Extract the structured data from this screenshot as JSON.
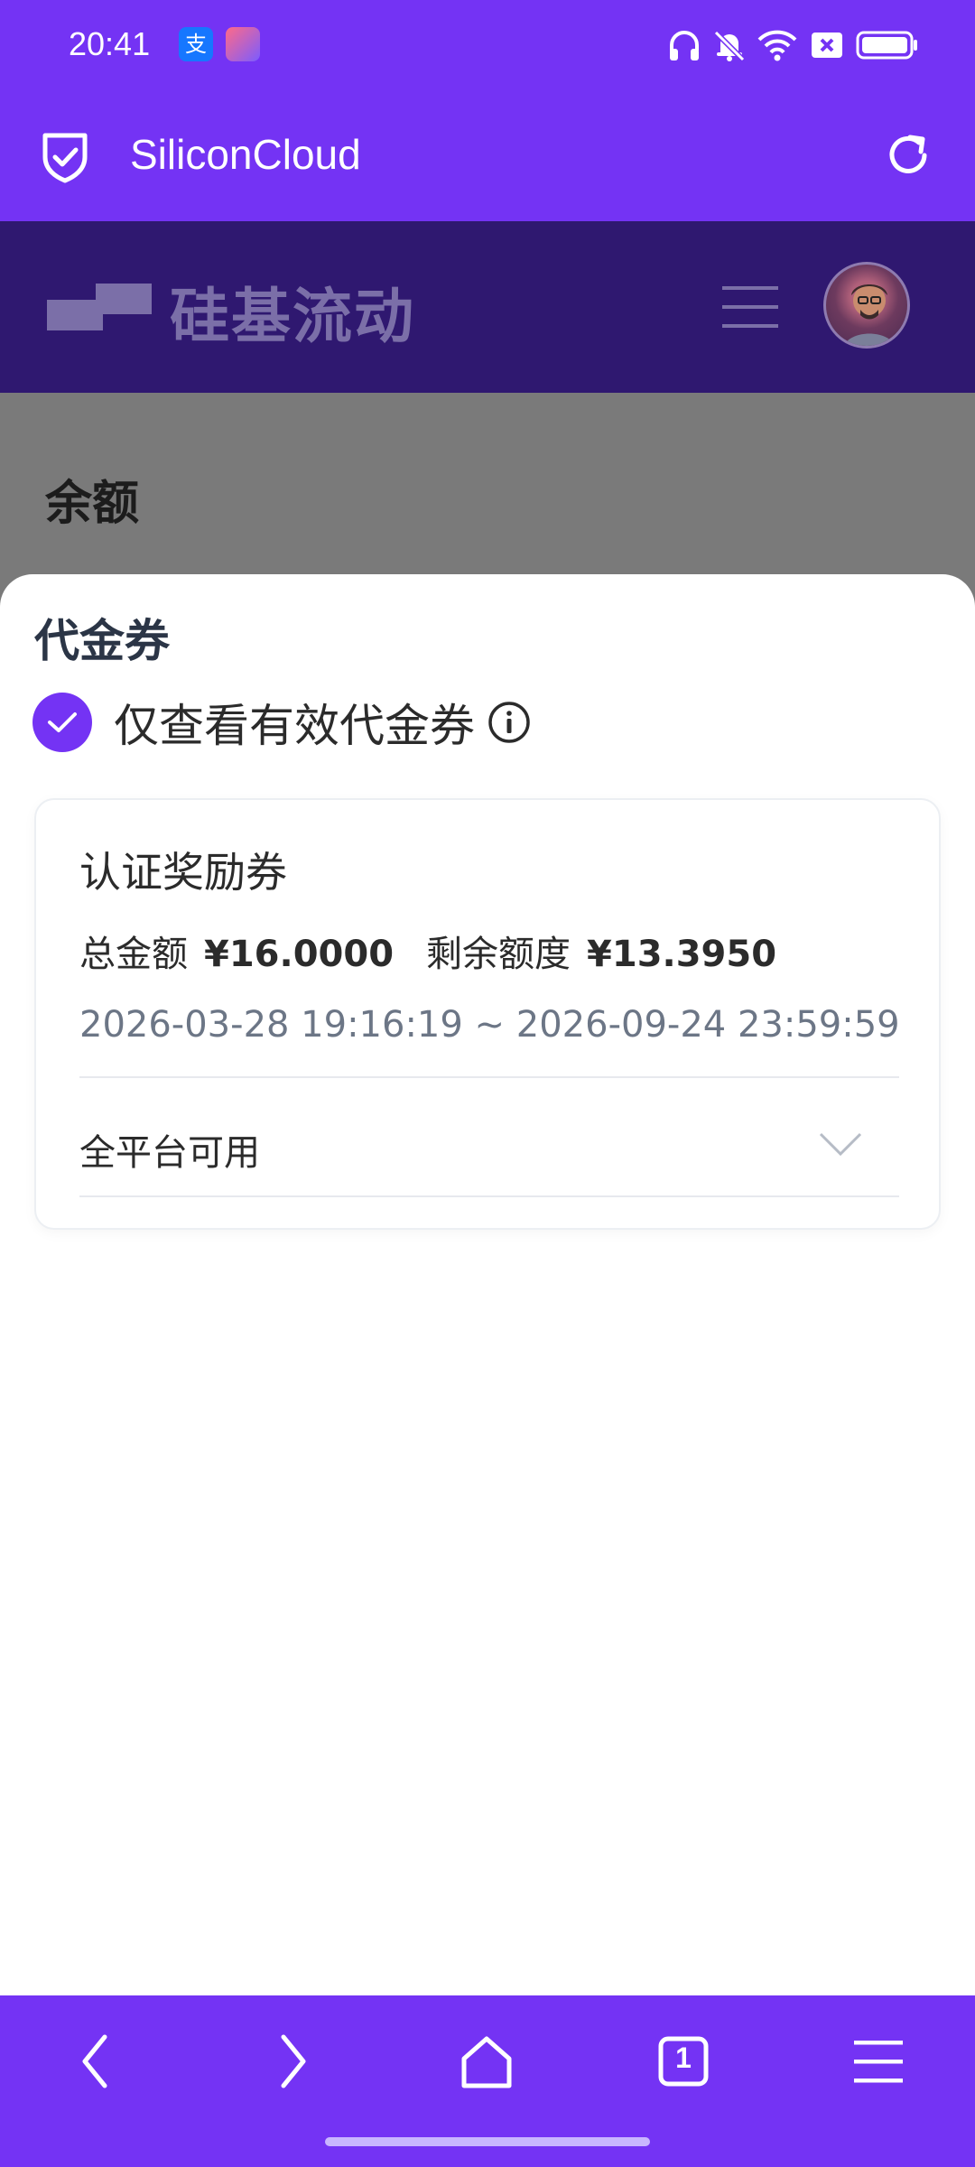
{
  "status_bar": {
    "time": "20:41",
    "app_icons": [
      "alipay-icon",
      "app-icon"
    ],
    "system_icons": [
      "headphones-icon",
      "bell-muted-icon",
      "wifi-icon",
      "close-box-icon",
      "battery-icon"
    ],
    "alipay_glyph": "支"
  },
  "browser": {
    "title": "SiliconCloud",
    "icons": [
      "shield-check-icon",
      "reload-icon"
    ]
  },
  "site_header": {
    "logo_text": "硅基流动",
    "icons": [
      "logo-mark-icon",
      "hamburger-menu-icon",
      "avatar"
    ]
  },
  "page": {
    "section_title": "余额"
  },
  "voucher_sheet": {
    "title": "代金券",
    "filter_label": "仅查看有效代金券",
    "filter_checked": true,
    "card": {
      "title": "认证奖励券",
      "total_label": "总金额",
      "total_value": "¥16.0000",
      "remaining_label": "剩余额度",
      "remaining_value": "¥13.3950",
      "validity": "2026-03-28 19:16:19 ~ 2026-09-24 23:59:59",
      "scope_label": "全平台可用"
    }
  },
  "bottom_nav": {
    "tab_count": "1",
    "icons": [
      "back-icon",
      "forward-icon",
      "home-icon",
      "tabs-icon",
      "menu-icon"
    ]
  },
  "colors": {
    "accent": "#7433f4",
    "header": "#2f1870",
    "muted_text": "#6c7686"
  }
}
